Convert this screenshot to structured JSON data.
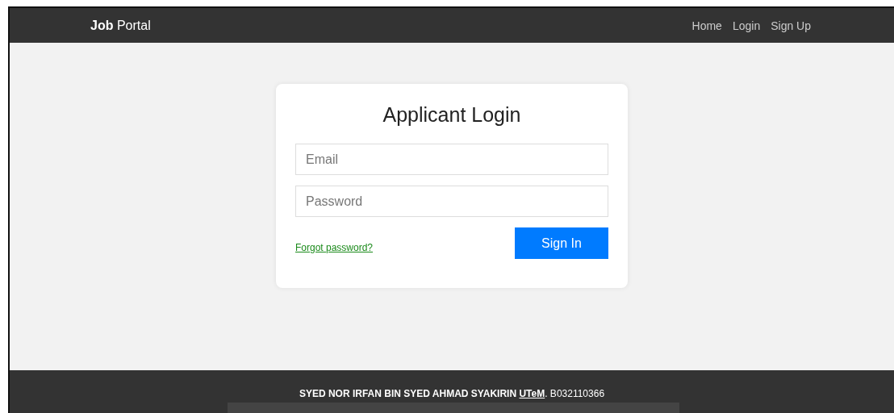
{
  "navbar": {
    "brand_bold": "Job",
    "brand_rest": "Portal",
    "links": [
      "Home",
      "Login",
      "Sign Up"
    ]
  },
  "login": {
    "title": "Applicant Login",
    "email": {
      "placeholder": "Email"
    },
    "password": {
      "placeholder": "Password"
    },
    "forgot_link": "Forgot password?",
    "submit": "Sign In"
  },
  "footer": {
    "name": "SYED NOR IRFAN BIN SYED AHMAD SYAKIRIN",
    "link": "UTeM",
    "suffix": ". B032110366"
  }
}
